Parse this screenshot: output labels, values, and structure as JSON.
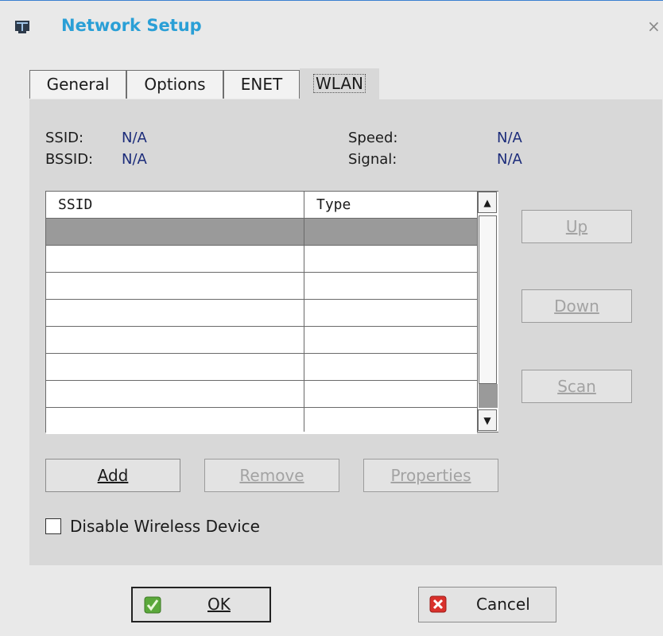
{
  "window": {
    "title": "Network Setup",
    "close_glyph": "×"
  },
  "tabs": [
    {
      "label": "General",
      "active": false
    },
    {
      "label": "Options",
      "active": false
    },
    {
      "label": "ENET",
      "active": false
    },
    {
      "label": "WLAN",
      "active": true
    }
  ],
  "info": {
    "ssid_label": "SSID:",
    "ssid_value": "N/A",
    "bssid_label": "BSSID:",
    "bssid_value": "N/A",
    "speed_label": "Speed:",
    "speed_value": "N/A",
    "signal_label": "Signal:",
    "signal_value": "N/A"
  },
  "table": {
    "columns": [
      "SSID",
      "Type"
    ],
    "rows": [
      [
        "",
        ""
      ],
      [
        "",
        ""
      ],
      [
        "",
        ""
      ],
      [
        "",
        ""
      ],
      [
        "",
        ""
      ],
      [
        "",
        ""
      ],
      [
        "",
        ""
      ],
      [
        "",
        ""
      ]
    ],
    "selected_row": 0
  },
  "side_buttons": {
    "up": "Up",
    "down": "Down",
    "scan": "Scan"
  },
  "row_buttons": {
    "add": "Add",
    "remove": "Remove",
    "properties": "Properties"
  },
  "checkbox": {
    "label": "Disable Wireless Device",
    "checked": false
  },
  "footer": {
    "ok": "OK",
    "cancel": "Cancel"
  },
  "colors": {
    "title": "#2a9fd6",
    "value": "#1c2c7a",
    "selected_row": "#9a9a9a",
    "ok_icon": "#5aa83a",
    "cancel_icon": "#d9302b"
  }
}
